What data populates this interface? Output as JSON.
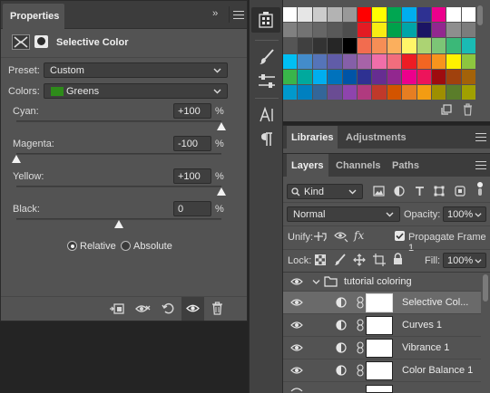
{
  "properties": {
    "tab_label": "Properties",
    "collapse_glyph": "››",
    "adjustment_title": "Selective Color",
    "preset_label": "Preset:",
    "preset_value": "Custom",
    "colors_label": "Colors:",
    "colors_value": "Greens",
    "colors_swatch": "#2e8b1a",
    "sliders": [
      {
        "label": "Cyan:",
        "value": "+100",
        "unit": "%",
        "level": 1.0
      },
      {
        "label": "Magenta:",
        "value": "-100",
        "unit": "%",
        "level": 0.0
      },
      {
        "label": "Yellow:",
        "value": "+100",
        "unit": "%",
        "level": 1.0
      },
      {
        "label": "Black:",
        "value": "0",
        "unit": "%",
        "level": 0.5
      }
    ],
    "mode_relative": "Relative",
    "mode_absolute": "Absolute",
    "selected_mode": "Relative",
    "bottom_icons": [
      "clip-to-layer-icon",
      "view-previous-state-icon",
      "reset-icon",
      "visibility-icon",
      "delete-icon"
    ]
  },
  "tools": [
    "swatches-panel-icon",
    "brush-settings-icon",
    "brush-presets-icon",
    "character-icon",
    "paragraph-icon"
  ],
  "swatches": {
    "rows": [
      [
        "#ffffff",
        "#e6e6e6",
        "#cccccc",
        "#b3b3b3",
        "#999999",
        "#ff0000",
        "#ffff00",
        "#00a651",
        "#00aeef",
        "#2e3192",
        "#ec008c",
        "#ffffff",
        "#ffffff"
      ],
      [
        "#808080",
        "#737373",
        "#666666",
        "#595959",
        "#4d4d4d",
        "#e31b23",
        "#f7ec13",
        "#00a14b",
        "#00a5a8",
        "#1b1464",
        "#92278f",
        "#8e8e8e",
        "#7c7c7c"
      ],
      [
        "#555555",
        "#404040",
        "#333333",
        "#262626",
        "#000000",
        "#f26c4f",
        "#f68e56",
        "#fbaf5d",
        "#fff568",
        "#acd373",
        "#7cc576",
        "#3bb878",
        "#1abbb4"
      ],
      [
        "#00bff3",
        "#438ccb",
        "#5574b9",
        "#605ca8",
        "#855fa8",
        "#a763a8",
        "#f06ea9",
        "#f26d7d",
        "#ed1c24",
        "#f26522",
        "#f7941d",
        "#fff200",
        "#8dc63f"
      ],
      [
        "#39b54a",
        "#00a99d",
        "#00aeef",
        "#0072bc",
        "#0054a6",
        "#2e3192",
        "#662d91",
        "#92278f",
        "#ec008c",
        "#ed145b",
        "#9e0b0f",
        "#a0410d",
        "#a36209"
      ],
      [
        "#0099cc",
        "#0080c0",
        "#336699",
        "#6a4c93",
        "#8e44ad",
        "#b03a7f",
        "#c0392b",
        "#d35400",
        "#e67e22",
        "#f39c12",
        "#9e8f00",
        "#5a7d2a",
        "#a0a000"
      ]
    ],
    "new_swatch_icon": "new-swatch-icon",
    "delete_icon": "trash-icon"
  },
  "libraries": {
    "tabs": [
      "Libraries",
      "Adjustments"
    ]
  },
  "layers": {
    "tabs": [
      "Layers",
      "Channels",
      "Paths"
    ],
    "filter_kind": "Kind",
    "blend_mode": "Normal",
    "opacity_label": "Opacity:",
    "opacity_value": "100%",
    "unify_label": "Unify:",
    "propagate_label": "Propagate Frame 1",
    "propagate_checked": true,
    "lock_label": "Lock:",
    "fill_label": "Fill:",
    "fill_value": "100%",
    "group_name": "tutorial coloring",
    "items": [
      {
        "name": "Selective Col...",
        "selected": true
      },
      {
        "name": "Curves 1",
        "selected": false
      },
      {
        "name": "Vibrance 1",
        "selected": false
      },
      {
        "name": "Color Balance 1",
        "selected": false
      }
    ]
  }
}
